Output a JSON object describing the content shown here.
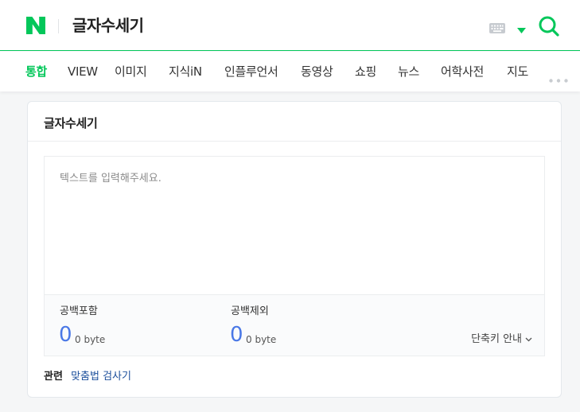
{
  "header": {
    "logo_letter": "N",
    "search_query": "글자수세기",
    "brand_color": "#03c75a"
  },
  "tabs": [
    {
      "label": "통합",
      "active": true
    },
    {
      "label": "VIEW"
    },
    {
      "label": "이미지"
    },
    {
      "label": "지식iN"
    },
    {
      "label": "인플루언서"
    },
    {
      "label": "동영상"
    },
    {
      "label": "쇼핑"
    },
    {
      "label": "뉴스"
    },
    {
      "label": "어학사전"
    },
    {
      "label": "지도"
    }
  ],
  "counter": {
    "title": "글자수세기",
    "placeholder": "텍스트를 입력해주세요.",
    "with_spaces": {
      "label": "공백포함",
      "count": "0",
      "bytes": "0 byte"
    },
    "without_spaces": {
      "label": "공백제외",
      "count": "0",
      "bytes": "0 byte"
    },
    "shortcut_label": "단축키 안내",
    "value_color": "#4a78e6"
  },
  "related": {
    "label": "관련",
    "link": "맞춤법 검사기"
  }
}
